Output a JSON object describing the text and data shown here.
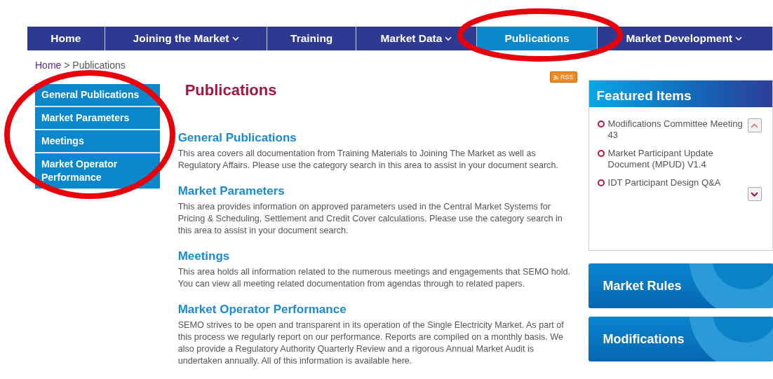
{
  "nav": [
    {
      "label": "Home",
      "dropdown": false,
      "selected": false
    },
    {
      "label": "Joining the Market",
      "dropdown": true,
      "selected": false
    },
    {
      "label": "Training",
      "dropdown": false,
      "selected": false
    },
    {
      "label": "Market Data",
      "dropdown": true,
      "selected": false
    },
    {
      "label": "Publications",
      "dropdown": false,
      "selected": true
    },
    {
      "label": "Market Development",
      "dropdown": true,
      "selected": false
    }
  ],
  "breadcrumb": {
    "link": "Home",
    "separator": ">",
    "current": "Publications"
  },
  "sidebar": {
    "items": [
      "General Publications",
      "Market Parameters",
      "Meetings",
      "Market Operator Performance"
    ]
  },
  "main": {
    "title": "Publications",
    "rss": "RSS",
    "sections": [
      {
        "heading": "General Publications",
        "text": "This area covers all documentation from Training Materials to Joining The Market as well as Regulatory Affairs.  Please use the category search in this area to assist in your document search."
      },
      {
        "heading": "Market Parameters",
        "text": "This area provides information on approved parameters used in the Central Market Systems for Pricing & Scheduling, Settlement and Credit Cover calculations.  Please use the category search in this area to assist in your document search."
      },
      {
        "heading": "Meetings",
        "text": "This area holds all information related to the numerous meetings and engagements that SEMO hold. You can view all meeting related documentation from agendas through to related papers."
      },
      {
        "heading": "Market Operator Performance",
        "text": "SEMO strives to be open and transparent in its operation of the Single Electricity Market. As part of this process we regularly report on our performance. Reports are compiled on a monthly basis.  We also provide a Regulatory Authority Quarterly Review and a rigorous Annual Market Audit is undertaken annually.  All of this information is available here."
      }
    ]
  },
  "featured": {
    "title": "Featured Items",
    "items": [
      "Modifications Committee Meeting 43",
      "Market Participant Update Document (MPUD) V1.4",
      "IDT Participant Design Q&A"
    ]
  },
  "promos": [
    "Market Rules",
    "Modifications"
  ],
  "annotations": [
    {
      "kind": "ellipse"
    },
    {
      "kind": "ellipse"
    }
  ]
}
